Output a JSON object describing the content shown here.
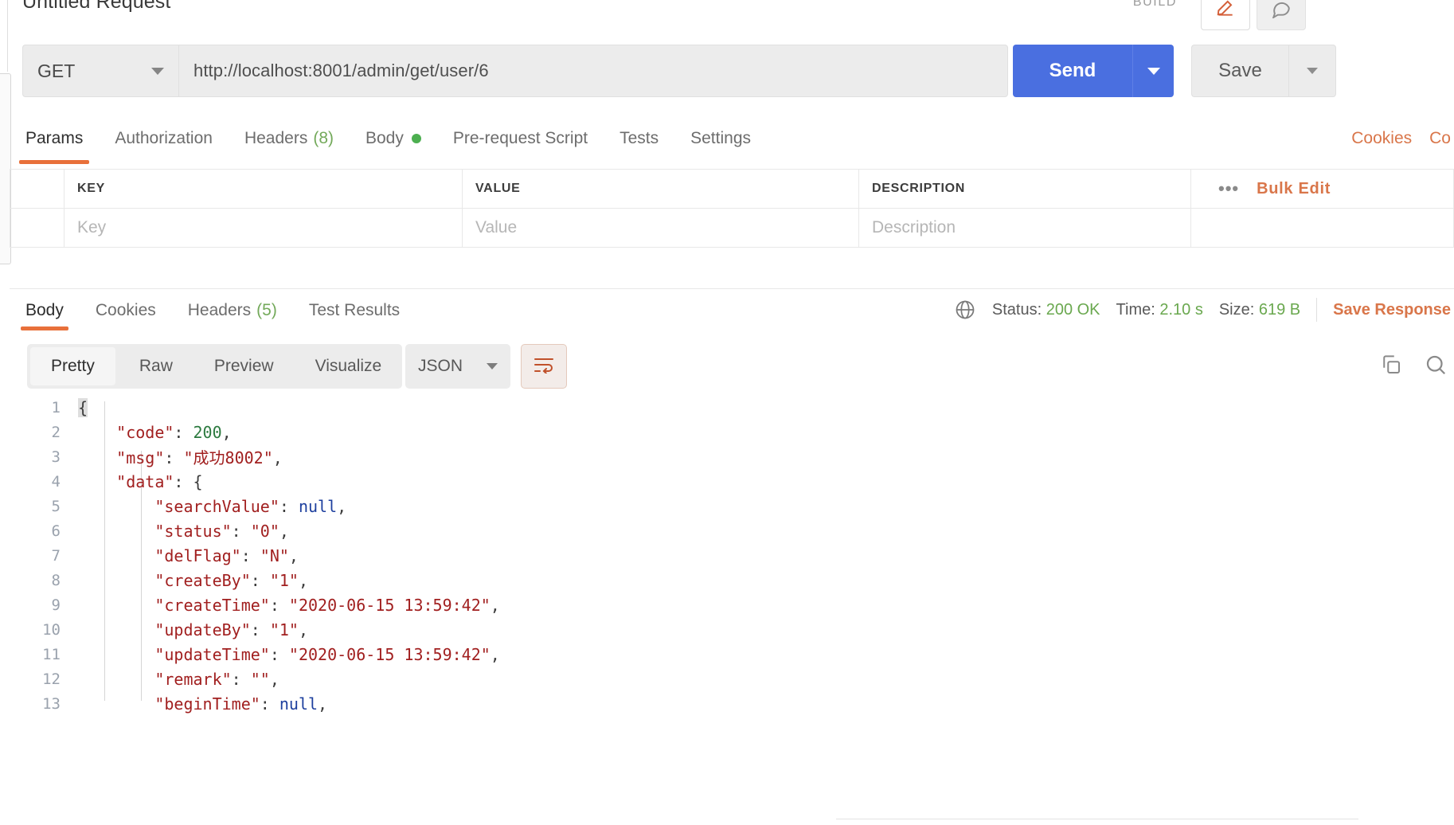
{
  "header": {
    "request_title": "Untitled Request",
    "build_label": "BUILD",
    "pencil_icon": "edit-pencil-icon",
    "comment_icon": "comment-icon"
  },
  "url_bar": {
    "method": "GET",
    "url": "http://localhost:8001/admin/get/user/6",
    "send_label": "Send",
    "save_label": "Save"
  },
  "request_tabs": [
    {
      "label": "Params",
      "active": true
    },
    {
      "label": "Authorization",
      "active": false
    },
    {
      "label": "Headers",
      "count": "(8)",
      "active": false
    },
    {
      "label": "Body",
      "dot": true,
      "active": false
    },
    {
      "label": "Pre-request Script",
      "active": false
    },
    {
      "label": "Tests",
      "active": false
    },
    {
      "label": "Settings",
      "active": false
    }
  ],
  "request_tabs_right": [
    {
      "label": "Cookies"
    },
    {
      "label": "Co"
    }
  ],
  "params_table": {
    "columns": [
      "KEY",
      "VALUE",
      "DESCRIPTION"
    ],
    "placeholder_row": [
      "Key",
      "Value",
      "Description"
    ],
    "actions": {
      "more": "•••",
      "bulk_edit": "Bulk Edit"
    }
  },
  "response_tabs": [
    {
      "label": "Body",
      "active": true
    },
    {
      "label": "Cookies",
      "active": false
    },
    {
      "label": "Headers",
      "count": "(5)",
      "active": false
    },
    {
      "label": "Test Results",
      "active": false
    }
  ],
  "response_meta": {
    "globe_icon": "globe-icon",
    "status_label": "Status:",
    "status_value": "200 OK",
    "time_label": "Time:",
    "time_value": "2.10 s",
    "size_label": "Size:",
    "size_value": "619 B",
    "save_response": "Save Response"
  },
  "format_bar": {
    "modes": [
      {
        "label": "Pretty",
        "active": true
      },
      {
        "label": "Raw",
        "active": false
      },
      {
        "label": "Preview",
        "active": false
      },
      {
        "label": "Visualize",
        "active": false
      }
    ],
    "language": "JSON",
    "wrap_icon": "word-wrap-icon",
    "copy_icon": "copy-icon",
    "search_icon": "search-icon"
  },
  "response_body": {
    "language": "json",
    "lines": [
      {
        "n": "1",
        "parts": [
          {
            "t": "{",
            "c": "cursor-brace"
          }
        ]
      },
      {
        "n": "2",
        "parts": [
          {
            "t": "    ",
            "c": "punct"
          },
          {
            "t": "\"code\"",
            "c": "k"
          },
          {
            "t": ": ",
            "c": "punct"
          },
          {
            "t": "200",
            "c": "num"
          },
          {
            "t": ",",
            "c": "punct"
          }
        ]
      },
      {
        "n": "3",
        "parts": [
          {
            "t": "    ",
            "c": "punct"
          },
          {
            "t": "\"msg\"",
            "c": "k"
          },
          {
            "t": ": ",
            "c": "punct"
          },
          {
            "t": "\"成功8002\"",
            "c": "s"
          },
          {
            "t": ",",
            "c": "punct"
          }
        ]
      },
      {
        "n": "4",
        "parts": [
          {
            "t": "    ",
            "c": "punct"
          },
          {
            "t": "\"data\"",
            "c": "k"
          },
          {
            "t": ": {",
            "c": "punct"
          }
        ]
      },
      {
        "n": "5",
        "parts": [
          {
            "t": "        ",
            "c": "punct"
          },
          {
            "t": "\"searchValue\"",
            "c": "k"
          },
          {
            "t": ": ",
            "c": "punct"
          },
          {
            "t": "null",
            "c": "nul"
          },
          {
            "t": ",",
            "c": "punct"
          }
        ]
      },
      {
        "n": "6",
        "parts": [
          {
            "t": "        ",
            "c": "punct"
          },
          {
            "t": "\"status\"",
            "c": "k"
          },
          {
            "t": ": ",
            "c": "punct"
          },
          {
            "t": "\"0\"",
            "c": "s"
          },
          {
            "t": ",",
            "c": "punct"
          }
        ]
      },
      {
        "n": "7",
        "parts": [
          {
            "t": "        ",
            "c": "punct"
          },
          {
            "t": "\"delFlag\"",
            "c": "k"
          },
          {
            "t": ": ",
            "c": "punct"
          },
          {
            "t": "\"N\"",
            "c": "s"
          },
          {
            "t": ",",
            "c": "punct"
          }
        ]
      },
      {
        "n": "8",
        "parts": [
          {
            "t": "        ",
            "c": "punct"
          },
          {
            "t": "\"createBy\"",
            "c": "k"
          },
          {
            "t": ": ",
            "c": "punct"
          },
          {
            "t": "\"1\"",
            "c": "s"
          },
          {
            "t": ",",
            "c": "punct"
          }
        ]
      },
      {
        "n": "9",
        "parts": [
          {
            "t": "        ",
            "c": "punct"
          },
          {
            "t": "\"createTime\"",
            "c": "k"
          },
          {
            "t": ": ",
            "c": "punct"
          },
          {
            "t": "\"2020-06-15 13:59:42\"",
            "c": "s"
          },
          {
            "t": ",",
            "c": "punct"
          }
        ]
      },
      {
        "n": "10",
        "parts": [
          {
            "t": "        ",
            "c": "punct"
          },
          {
            "t": "\"updateBy\"",
            "c": "k"
          },
          {
            "t": ": ",
            "c": "punct"
          },
          {
            "t": "\"1\"",
            "c": "s"
          },
          {
            "t": ",",
            "c": "punct"
          }
        ]
      },
      {
        "n": "11",
        "parts": [
          {
            "t": "        ",
            "c": "punct"
          },
          {
            "t": "\"updateTime\"",
            "c": "k"
          },
          {
            "t": ": ",
            "c": "punct"
          },
          {
            "t": "\"2020-06-15 13:59:42\"",
            "c": "s"
          },
          {
            "t": ",",
            "c": "punct"
          }
        ]
      },
      {
        "n": "12",
        "parts": [
          {
            "t": "        ",
            "c": "punct"
          },
          {
            "t": "\"remark\"",
            "c": "k"
          },
          {
            "t": ": ",
            "c": "punct"
          },
          {
            "t": "\"\"",
            "c": "s"
          },
          {
            "t": ",",
            "c": "punct"
          }
        ]
      },
      {
        "n": "13",
        "parts": [
          {
            "t": "        ",
            "c": "punct"
          },
          {
            "t": "\"beginTime\"",
            "c": "k"
          },
          {
            "t": ": ",
            "c": "punct"
          },
          {
            "t": "null",
            "c": "nul"
          },
          {
            "t": ",",
            "c": "punct"
          }
        ]
      }
    ]
  },
  "colors": {
    "accent_orange": "#e8703a",
    "send_blue": "#4a6fe0",
    "status_green": "#6aa84f",
    "link_orange": "#d9764a"
  }
}
